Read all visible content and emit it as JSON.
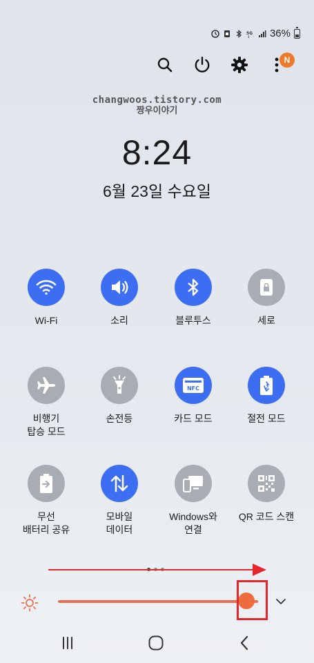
{
  "status_bar": {
    "battery_text": "36%"
  },
  "watermark": {
    "line1": "changwoos.tistory.com",
    "line2": "짱우이야기"
  },
  "clock": {
    "time": "8:24",
    "date": "6월 23일 수요일"
  },
  "top_actions": {
    "badge": "N"
  },
  "tiles": [
    {
      "label": "Wi-Fi",
      "icon": "wifi-icon",
      "active": true
    },
    {
      "label": "소리",
      "icon": "speaker-icon",
      "active": true
    },
    {
      "label": "블루투스",
      "icon": "bluetooth-icon",
      "active": true
    },
    {
      "label": "세로",
      "icon": "lock-rotation-icon",
      "active": false
    },
    {
      "label": "비행기\n탑승 모드",
      "icon": "airplane-icon",
      "active": false
    },
    {
      "label": "손전등",
      "icon": "flashlight-icon",
      "active": false
    },
    {
      "label": "카드 모드",
      "icon": "nfc-icon",
      "active": true
    },
    {
      "label": "절전 모드",
      "icon": "battery-saver-icon",
      "active": true
    },
    {
      "label": "무선\n배터리 공유",
      "icon": "wireless-powershare-icon",
      "active": false
    },
    {
      "label": "모바일\n데이터",
      "icon": "mobile-data-icon",
      "active": true
    },
    {
      "label": "Windows와\n연결",
      "icon": "link-to-windows-icon",
      "active": false
    },
    {
      "label": "QR 코드 스캔",
      "icon": "qr-code-icon",
      "active": false
    }
  ],
  "brightness": {
    "level_fraction": 0.94
  },
  "colors": {
    "accent": "#3d6df0",
    "inactive": "#a8adb4",
    "brightness": "#ee6b3e",
    "annotation": "#e5262a"
  }
}
